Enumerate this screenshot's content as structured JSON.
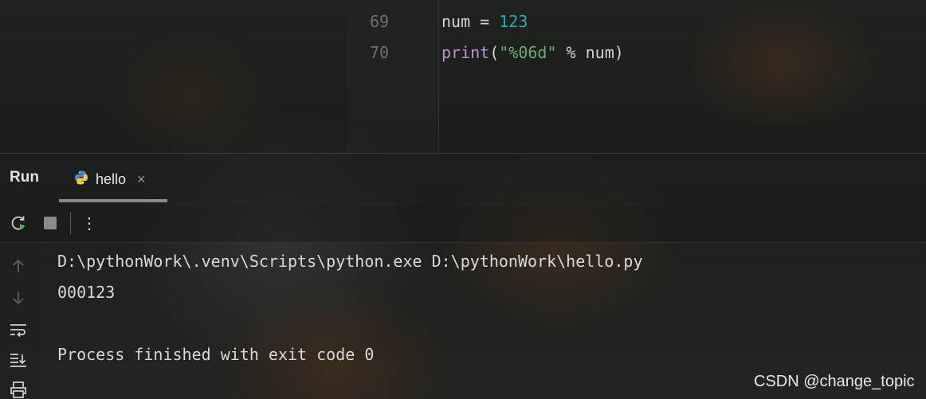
{
  "editor": {
    "lines": [
      {
        "number": "69",
        "tokens": {
          "var": "num",
          "op": " = ",
          "value": "123"
        }
      },
      {
        "number": "70",
        "tokens": {
          "fn": "print",
          "open": "(",
          "str": "\"%06d\"",
          "rest": " % num)"
        }
      }
    ]
  },
  "run_panel": {
    "title": "Run",
    "tab": {
      "label": "hello",
      "icon": "python-icon",
      "close": "×"
    },
    "toolbar": {
      "rerun_icon": "rerun-icon",
      "stop_icon": "stop-icon",
      "more_icon": "more-vertical-icon",
      "more_glyph": "⋮"
    },
    "rail": [
      "arrow-up-icon",
      "arrow-down-icon",
      "soft-wrap-icon",
      "scroll-to-end-icon",
      "print-icon"
    ]
  },
  "console": {
    "lines": [
      "D:\\pythonWork\\.venv\\Scripts\\python.exe D:\\pythonWork\\hello.py",
      "000123",
      "",
      "Process finished with exit code 0"
    ]
  },
  "watermark": "CSDN @change_topic",
  "colors": {
    "number_literal": "#2aacb8",
    "function": "#b893d4",
    "string": "#6aab73",
    "rerun_green": "#4caf50"
  }
}
